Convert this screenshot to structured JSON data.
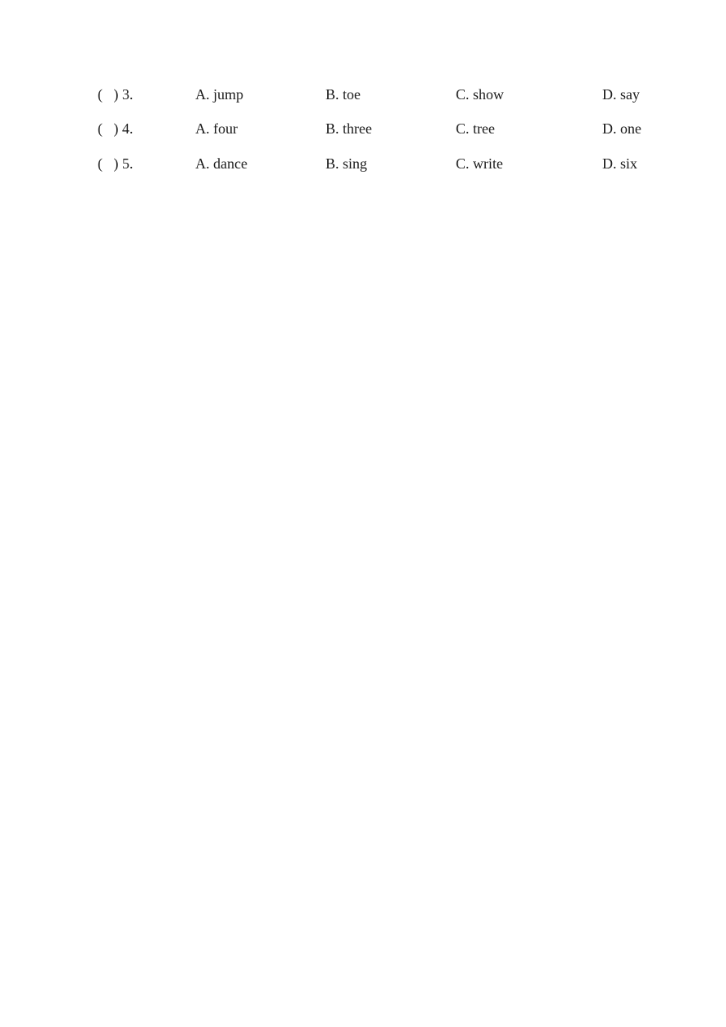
{
  "rows": [
    {
      "id": "row-3",
      "bracket": "(",
      "number": ") 3.",
      "a": "A. jump",
      "b": "B. toe",
      "c": "C. show",
      "d": "D. say"
    },
    {
      "id": "row-4",
      "bracket": "(",
      "number": ") 4.",
      "a": "A. four",
      "b": "B. three",
      "c": "C. tree",
      "d": "D. one"
    },
    {
      "id": "row-5",
      "bracket": "(",
      "number": ") 5.",
      "a": "A. dance",
      "b": "B. sing",
      "c": "C. write",
      "d": "D. six"
    }
  ]
}
